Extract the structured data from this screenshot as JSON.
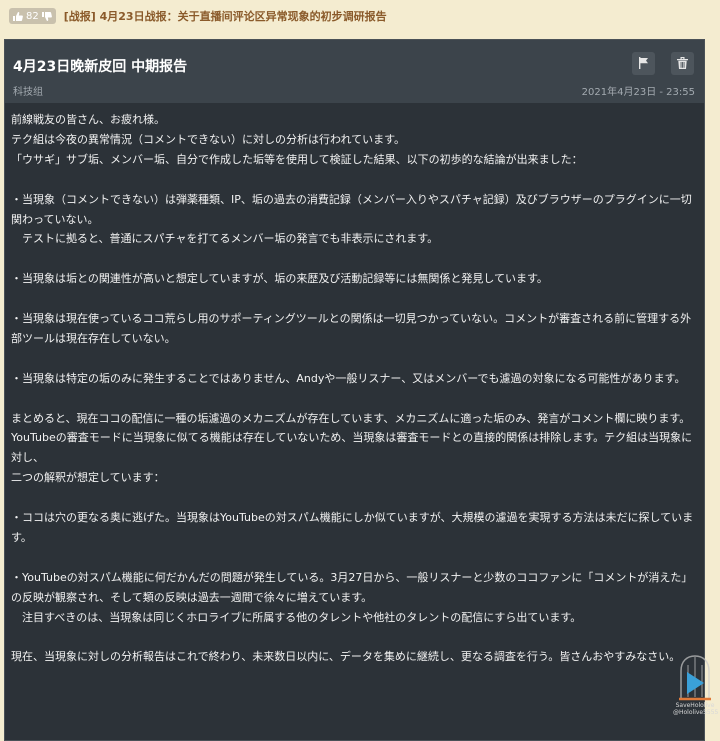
{
  "topbar": {
    "vote_count": "82",
    "thread_title": "[战报] 4月23日战报：关于直播间评论区异常现象的初步调研报告"
  },
  "post": {
    "title": "4月23日晚新皮回 中期报告",
    "author": "科技组",
    "timestamp": "2021年4月23日 - 23:55",
    "lines": [
      "前線戦友の皆さん、お疲れ様。",
      "テク組は今夜の異常情況（コメントできない）に対しの分析は行われています。",
      "「ウサギ」サブ垢、メンバー垢、自分で作成した垢等を使用して検証した結果、以下の初歩的な結論が出来ました：",
      "",
      "・当現象（コメントできない）は弾薬種類、IP、垢の過去の消費記録（メンバー入りやスパチャ記録）及びブラウザーのプラグインに一切関わっていない。",
      "　テストに拠ると、普通にスパチャを打てるメンバー垢の発言でも非表示にされます。",
      "",
      "・当現象は垢との関連性が高いと想定していますが、垢の来歴及び活動記録等には無関係と発見しています。",
      "",
      "・当現象は現在使っているココ荒らし用のサポーティングツールとの関係は一切見つかっていない。コメントが審査される前に管理する外部ツールは現在存在していない。",
      "",
      "・当現象は特定の垢のみに発生することではありません、Andyや一般リスナー、又はメンバーでも濾過の対象になる可能性があります。",
      "",
      "まとめると、現在ココの配信に一種の垢濾過のメカニズムが存在しています、メカニズムに適った垢のみ、発言がコメント欄に映ります。",
      "YouTubeの審査モードに当現象に似てる機能は存在していないため、当現象は審査モードとの直接的関係は排除します。テク組は当現象に対し、",
      "二つの解釈が想定しています：",
      "",
      "・ココは穴の更なる奥に逃げた。当現象はYouTubeの対スパム機能にしか似ていますが、大規模の濾過を実現する方法は未だに探しています。",
      "",
      "・YouTubeの対スパム機能に何だかんだの問題が発生している。3月27日から、一般リスナーと少数のココファンに「コメントが消えた」の反映が観察され、そして類の反映は過去一週間で徐々に増えています。",
      "　注目すべきのは、当現象は同じくホロライブに所属する他のタレントや他社のタレントの配信にすら出ています。",
      "",
      "現在、当現象に対しの分析報告はこれで終わり、未来数日以内に、データを集めに継続し、更なる調査を行う。皆さんおやすみなさい。"
    ]
  },
  "watermark": {
    "line1": "SaveHololive",
    "line2": "@Hololive5555"
  },
  "colors": {
    "page_bg": "#f4ecd0",
    "card_bg": "#2c3238",
    "header_bg": "#3c444b",
    "title_accent": "#8a5a2a"
  },
  "icons": {
    "vote": "thumbs-up-icon",
    "flag": "flag-icon",
    "delete": "trash-icon",
    "watermark": "play-cage-icon"
  }
}
